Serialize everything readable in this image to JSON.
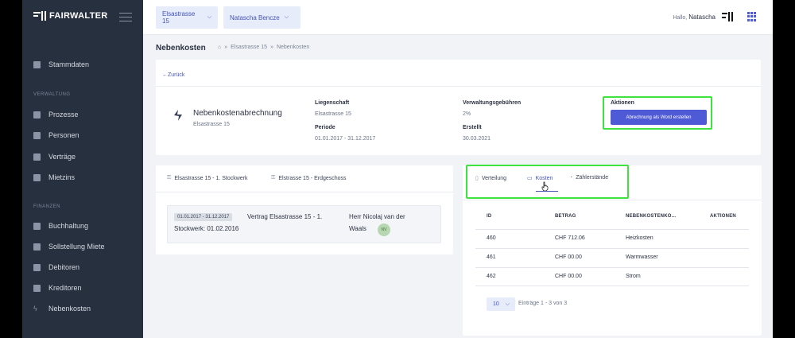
{
  "app": {
    "brand": "FAIRWALTER"
  },
  "sidebar": {
    "items": [
      {
        "label": "Stammdaten",
        "icon": "database-icon"
      },
      {
        "label": "Prozesse",
        "icon": "process-icon"
      },
      {
        "label": "Personen",
        "icon": "people-icon"
      },
      {
        "label": "Verträge",
        "icon": "contract-icon"
      },
      {
        "label": "Mietzins",
        "icon": "coins-icon"
      },
      {
        "label": "Buchhaltung",
        "icon": "ledger-icon"
      },
      {
        "label": "Sollstellung Miete",
        "icon": "document-icon"
      },
      {
        "label": "Debitoren",
        "icon": "debitor-icon"
      },
      {
        "label": "Kreditoren",
        "icon": "creditor-icon"
      },
      {
        "label": "Nebenkosten",
        "icon": "flash-icon"
      }
    ],
    "sections": [
      "VERWALTUNG",
      "FINANZEN"
    ]
  },
  "topbar": {
    "property_select": "Elsastrasse 15",
    "person_select": "Natascha Bencze",
    "greeting": "Hallo,",
    "user_name": "Natascha"
  },
  "page": {
    "title": "Nebenkosten",
    "breadcrumb": [
      "Elsastrasse 15",
      "Nebenkosten"
    ],
    "back_label": "←Zurück"
  },
  "summary": {
    "heading": "Nebenkostenabrechnung",
    "subheading": "Elsastrasse 15",
    "liegenschaft_label": "Liegenschaft",
    "liegenschaft_value": "Elsastrasse 15",
    "periode_label": "Periode",
    "periode_value": "01.01.2017 - 31.12.2017",
    "gebuehren_label": "Verwaltungsgebühren",
    "gebuehren_value": "2%",
    "erstellt_label": "Erstellt",
    "erstellt_value": "30.03.2021",
    "aktionen_label": "Aktionen",
    "word_button": "Abrechnung als Word erstellen"
  },
  "properties": {
    "tabs": [
      "Elsastrasse 15 - 1. Stockwerk",
      "Elstrasse 15 - Erdgeschoss"
    ],
    "contract": {
      "period": "01.01.2017 - 31.12.2017",
      "title": "Vertrag Elsastrasse 15 - 1.",
      "title2": "Stockwerk: 01.02.2016",
      "tenant": "Herr Nicolaj van der",
      "tenant2": "Waals",
      "initials": "NV"
    }
  },
  "costs": {
    "tabs": [
      "Verteilung",
      "Kosten",
      "Zählerstände"
    ],
    "columns": [
      "ID",
      "BETRAG",
      "NEBENKOSTENKO...",
      "AKTIONEN"
    ],
    "rows": [
      {
        "id": "460",
        "betrag": "CHF 712.06",
        "art": "Heizkosten"
      },
      {
        "id": "461",
        "betrag": "CHF 00.00",
        "art": "Warmwasser"
      },
      {
        "id": "462",
        "betrag": "CHF 00.00",
        "art": "Strom"
      }
    ],
    "per_page": "10",
    "entries_text": "Einträge 1 - 3 von 3"
  },
  "colors": {
    "accent": "#4f5ad6",
    "sidebar": "#27303f",
    "highlight": "#3ee33e"
  }
}
